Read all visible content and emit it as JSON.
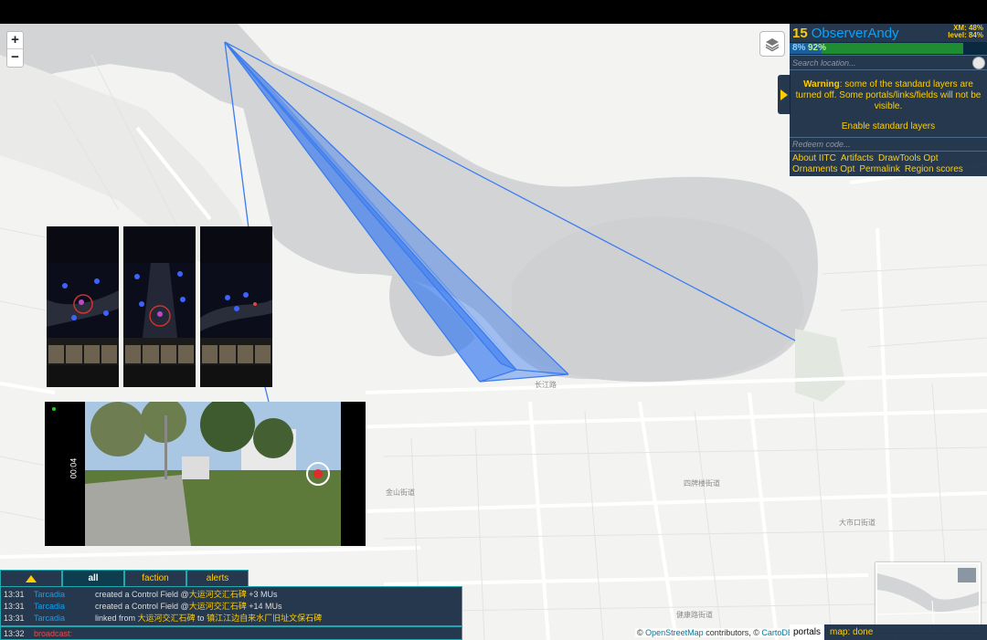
{
  "player": {
    "level": "15",
    "name": "ObserverAndy",
    "xm": "XM: 48%",
    "level_progress": "level: 84%",
    "res_pct": "8%",
    "ap_pct": "92%"
  },
  "search": {
    "placeholder": "Search location..."
  },
  "warning": {
    "bold": "Warning",
    "text": ": some of the standard layers are turned off. Some portals/links/fields will not be visible.",
    "enable": "Enable standard layers"
  },
  "redeem": {
    "placeholder": "Redeem code..."
  },
  "toolbox": {
    "links": [
      "About IITC",
      "Artifacts",
      "DrawTools Opt",
      "Ornaments Opt",
      "Permalink",
      "Region scores"
    ]
  },
  "zoom": {
    "in": "+",
    "out": "−"
  },
  "comm": {
    "tabs": [
      "all",
      "faction",
      "alerts"
    ],
    "messages": [
      {
        "time": "13:31",
        "user": "Tarcadia",
        "pre": "created a Control Field @",
        "portal": "大运河交汇石碑",
        "post": " +3 MUs"
      },
      {
        "time": "13:31",
        "user": "Tarcadia",
        "pre": "created a Control Field @",
        "portal": "大运河交汇石碑",
        "post": " +14 MUs"
      },
      {
        "time": "13:31",
        "user": "Tarcadia",
        "pre": "linked from ",
        "portal": "大运河交汇石碑",
        "post": " to ",
        "portal2": "镇江江边自来水厂旧址文保石碑"
      }
    ],
    "broadcast_time": "13:32",
    "broadcast_label": "broadcast:"
  },
  "attribution": {
    "prefix": "© ",
    "osm": "OpenStreetMap",
    "mid": " contributors, © ",
    "carto": "CartoDB"
  },
  "status": {
    "portals": "portals",
    "map": "map: done"
  },
  "map_labels": {
    "jinshan": "金山街道",
    "sipai": "四牌楼街道",
    "dashikou": "大市口街道",
    "jiankang": "健康路街道",
    "changjiang": "长江路"
  },
  "video": {
    "timer": "00:04"
  },
  "colors": {
    "accent": "#ffce00",
    "enl": "#03a4ff",
    "field": "#3b7cf0",
    "panel": "#0f233c"
  }
}
